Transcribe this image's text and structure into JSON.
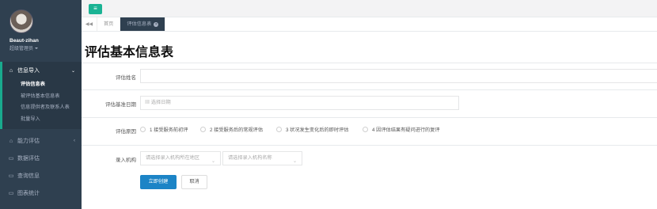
{
  "user": {
    "name": "Beaut-zihan",
    "role": "超级管理员"
  },
  "sidebar": {
    "groups": [
      {
        "label": "信息导入",
        "icon": "home-icon",
        "arrow": "⌄",
        "items": [
          "评估信息表",
          "被评估基本信息表",
          "信息提供者及联系人表",
          "批量导入"
        ],
        "current": "评估信息表"
      }
    ],
    "items": [
      {
        "label": "能力评估",
        "icon": "home-icon",
        "arrow": "‹"
      },
      {
        "label": "数据评估",
        "icon": "window-icon"
      },
      {
        "label": "查询信息",
        "icon": "window-icon"
      },
      {
        "label": "图表统计",
        "icon": "window-icon"
      }
    ]
  },
  "topbar": {
    "menu_icon": "≡"
  },
  "tabs": {
    "back": "◀◀",
    "home": "首页",
    "active": "评估信息表"
  },
  "page": {
    "title": "评估基本信息表"
  },
  "form": {
    "name_label": "评估姓名",
    "name_value": "",
    "date_label": "评估基准日期",
    "date_placeholder": "选择日期",
    "reason_label": "评估原因",
    "reasons": [
      "1 接受服务前初评",
      "2 接受服务后的常规评估",
      "3 状况发生变化后的即时评估",
      "4 因评估结果有疑问进行的复评"
    ],
    "org_label": "录入机构",
    "region_placeholder": "请选择录入机构所在地区",
    "org_placeholder": "请选择录入机构名称",
    "submit_label": "立即创建",
    "cancel_label": "取消"
  },
  "colors": {
    "sidebar_bg": "#2f4050",
    "accent": "#1ab394",
    "primary": "#1c84c6"
  }
}
